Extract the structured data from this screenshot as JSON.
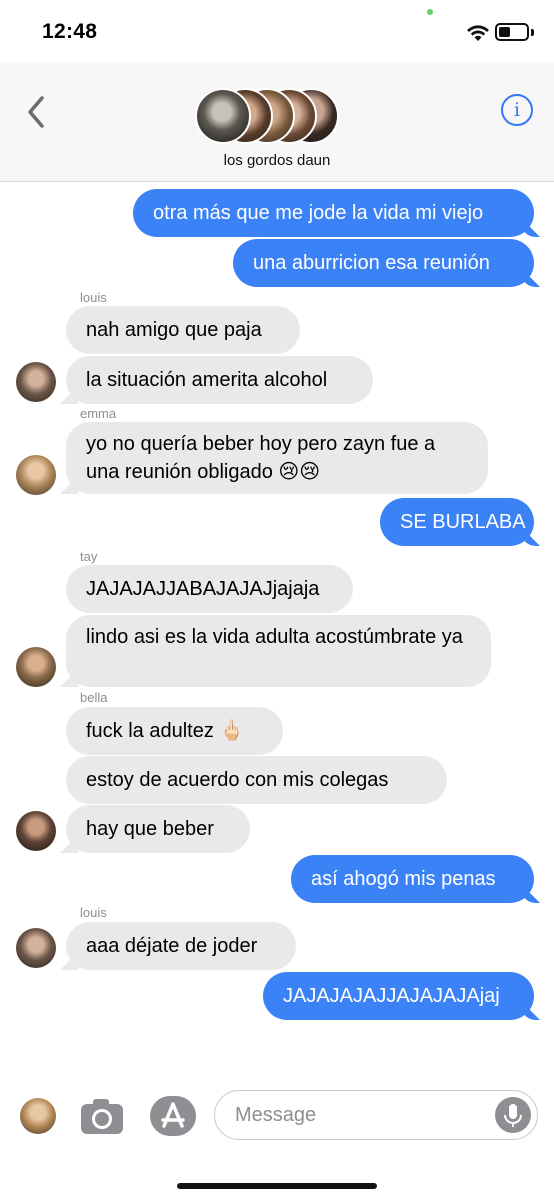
{
  "status_bar": {
    "time": "12:48",
    "wifi_icon": "wifi-icon",
    "battery_icon": "battery-icon"
  },
  "header": {
    "back_icon": "chevron-left-icon",
    "group_name": "los gordos daun",
    "info_icon": "info-icon",
    "info_glyph": "i"
  },
  "messages": [
    {
      "text": "otra más que me jode la vida mi viejo",
      "direction": "outgoing"
    },
    {
      "text": "una aburricion esa reunión",
      "direction": "outgoing"
    },
    {
      "sender": "louis"
    },
    {
      "text": "nah amigo que paja",
      "direction": "incoming"
    },
    {
      "text": "la situación amerita alcohol",
      "direction": "incoming"
    },
    {
      "sender": "emma"
    },
    {
      "text": "yo no quería beber hoy pero zayn fue a una reunión obligado 😢😢",
      "direction": "incoming"
    },
    {
      "text": "SE BURLABA",
      "direction": "outgoing"
    },
    {
      "sender": "tay"
    },
    {
      "text": "JAJAJAJJABAJAJAJjajaja",
      "direction": "incoming"
    },
    {
      "text": "lindo asi es la vida adulta acostúmbrate ya",
      "direction": "incoming"
    },
    {
      "sender": "bella"
    },
    {
      "text": "fuck la adultez 🖕🏻",
      "direction": "incoming"
    },
    {
      "text": "estoy de acuerdo con mis colegas",
      "direction": "incoming"
    },
    {
      "text": "hay que beber",
      "direction": "incoming"
    },
    {
      "text": "así ahogó mis penas",
      "direction": "outgoing"
    },
    {
      "sender": "louis"
    },
    {
      "text": "aaa déjate de joder",
      "direction": "incoming"
    },
    {
      "text": "JAJAJAJAJJAJAJAJAjaj",
      "direction": "outgoing"
    }
  ],
  "composer": {
    "placeholder": "Message",
    "camera_icon": "camera-icon",
    "appstore_icon": "app-store-icon",
    "mic_icon": "microphone-icon"
  },
  "colors": {
    "outgoing_bubble": "#3b82f6",
    "incoming_bubble": "#e9e9eb",
    "accent": "#3478f6"
  }
}
